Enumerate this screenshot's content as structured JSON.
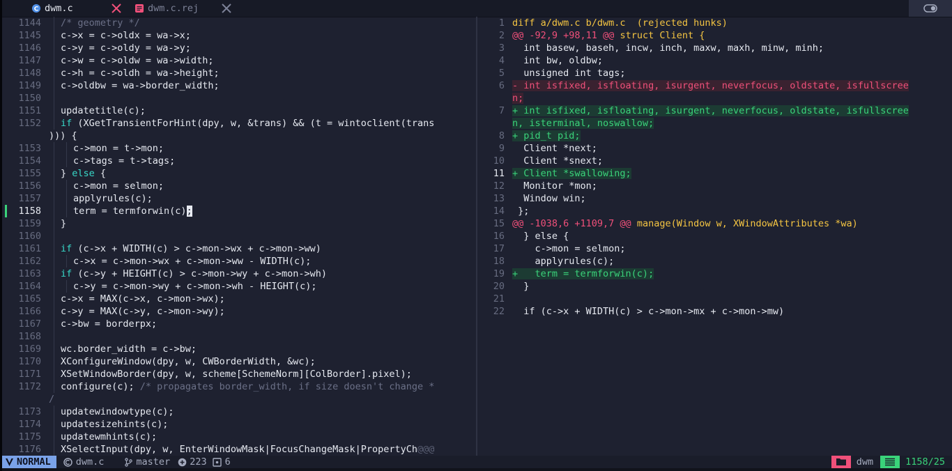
{
  "tabline": {
    "active_tab": "dwm.c",
    "inactive_tab": "dwm.c.rej"
  },
  "left_pane": {
    "lines": [
      {
        "n": "1144",
        "indent": 1,
        "parts": [
          {
            "t": "/* geometry */",
            "c": "cm"
          }
        ]
      },
      {
        "n": "1145",
        "indent": 1,
        "parts": [
          {
            "t": "c->x = c->oldx = wa->x;"
          }
        ]
      },
      {
        "n": "1146",
        "indent": 1,
        "parts": [
          {
            "t": "c->y = c->oldy = wa->y;"
          }
        ]
      },
      {
        "n": "1147",
        "indent": 1,
        "parts": [
          {
            "t": "c->w = c->oldw = wa->width;"
          }
        ]
      },
      {
        "n": "1148",
        "indent": 1,
        "parts": [
          {
            "t": "c->h = c->oldh = wa->height;"
          }
        ]
      },
      {
        "n": "1149",
        "indent": 1,
        "parts": [
          {
            "t": "c->oldbw = wa->border_width;"
          }
        ]
      },
      {
        "n": "1150",
        "indent": 1,
        "parts": []
      },
      {
        "n": "1151",
        "indent": 1,
        "parts": [
          {
            "t": "updatetitle(c);"
          }
        ]
      },
      {
        "n": "1152",
        "indent": 1,
        "parts": [
          {
            "t": "if",
            "c": "kw"
          },
          {
            "t": " (XGetTransientForHint(dpy, w, &trans) && (t = wintoclient(trans"
          }
        ]
      },
      {
        "n": "",
        "wrap": true,
        "parts": [
          {
            "t": "))) {"
          }
        ]
      },
      {
        "n": "1153",
        "indent": 2,
        "parts": [
          {
            "t": "c->mon = t->mon;"
          }
        ]
      },
      {
        "n": "1154",
        "indent": 2,
        "parts": [
          {
            "t": "c->tags = t->tags;"
          }
        ]
      },
      {
        "n": "1155",
        "indent": 1,
        "parts": [
          {
            "t": "} "
          },
          {
            "t": "else",
            "c": "kw"
          },
          {
            "t": " {"
          }
        ]
      },
      {
        "n": "1156",
        "indent": 2,
        "parts": [
          {
            "t": "c->mon = selmon;"
          }
        ]
      },
      {
        "n": "1157",
        "indent": 2,
        "parts": [
          {
            "t": "applyrules(c);"
          }
        ]
      },
      {
        "n": "1158",
        "indent": 2,
        "current": true,
        "sign": true,
        "parts": [
          {
            "t": "term = termforwin(c)"
          },
          {
            "t": ";",
            "c": "cursor"
          }
        ]
      },
      {
        "n": "1159",
        "indent": 1,
        "parts": [
          {
            "t": "}"
          }
        ]
      },
      {
        "n": "1160",
        "indent": 1,
        "parts": []
      },
      {
        "n": "1161",
        "indent": 1,
        "parts": [
          {
            "t": "if",
            "c": "kw"
          },
          {
            "t": " (c->x + WIDTH(c) > c->mon->wx + c->mon->ww)"
          }
        ]
      },
      {
        "n": "1162",
        "indent": 2,
        "parts": [
          {
            "t": "c->x = c->mon->wx + c->mon->ww - WIDTH(c);"
          }
        ]
      },
      {
        "n": "1163",
        "indent": 1,
        "parts": [
          {
            "t": "if",
            "c": "kw"
          },
          {
            "t": " (c->y + HEIGHT(c) > c->mon->wy + c->mon->wh)"
          }
        ]
      },
      {
        "n": "1164",
        "indent": 2,
        "parts": [
          {
            "t": "c->y = c->mon->wy + c->mon->wh - HEIGHT(c);"
          }
        ]
      },
      {
        "n": "1165",
        "indent": 1,
        "parts": [
          {
            "t": "c->x = MAX(c->x, c->mon->wx);"
          }
        ]
      },
      {
        "n": "1166",
        "indent": 1,
        "parts": [
          {
            "t": "c->y = MAX(c->y, c->mon->wy);"
          }
        ]
      },
      {
        "n": "1167",
        "indent": 1,
        "parts": [
          {
            "t": "c->bw = borderpx;"
          }
        ]
      },
      {
        "n": "1168",
        "indent": 1,
        "parts": []
      },
      {
        "n": "1169",
        "indent": 1,
        "parts": [
          {
            "t": "wc.border_width = c->bw;"
          }
        ]
      },
      {
        "n": "1170",
        "indent": 1,
        "parts": [
          {
            "t": "XConfigureWindow(dpy, w, CWBorderWidth, &wc);"
          }
        ]
      },
      {
        "n": "1171",
        "indent": 1,
        "parts": [
          {
            "t": "XSetWindowBorder(dpy, w, scheme[SchemeNorm][ColBorder].pixel);"
          }
        ]
      },
      {
        "n": "1172",
        "indent": 1,
        "parts": [
          {
            "t": "configure(c); "
          },
          {
            "t": "/* propagates border_width, if size doesn't change *",
            "c": "cm"
          }
        ]
      },
      {
        "n": "",
        "wrap": true,
        "parts": [
          {
            "t": "/",
            "c": "cm"
          }
        ]
      },
      {
        "n": "1173",
        "indent": 1,
        "parts": [
          {
            "t": "updatewindowtype(c);"
          }
        ]
      },
      {
        "n": "1174",
        "indent": 1,
        "parts": [
          {
            "t": "updatesizehints(c);"
          }
        ]
      },
      {
        "n": "1175",
        "indent": 1,
        "parts": [
          {
            "t": "updatewmhints(c);"
          }
        ]
      },
      {
        "n": "1176",
        "indent": 1,
        "parts": [
          {
            "t": "XSelectInput(dpy, w, EnterWindowMask|FocusChangeMask|PropertyCh"
          },
          {
            "t": "@@@",
            "c": "more"
          }
        ]
      }
    ]
  },
  "right_pane": {
    "lines": [
      {
        "n": "1",
        "parts": [
          {
            "t": "diff a/dwm.c b/dwm.c  (rejected hunks)",
            "c": "diff-header"
          }
        ]
      },
      {
        "n": "2",
        "parts": [
          {
            "t": "@@ -92,9 +98,11 @@",
            "c": "hunk-at"
          },
          {
            "t": " struct Client {",
            "c": "hunk-fn"
          }
        ]
      },
      {
        "n": "3",
        "parts": [
          {
            "t": "  int basew, baseh, incw, inch, maxw, maxh, minw, minh;"
          }
        ]
      },
      {
        "n": "4",
        "parts": [
          {
            "t": "  int bw, oldbw;"
          }
        ]
      },
      {
        "n": "5",
        "parts": [
          {
            "t": "  unsigned int tags;"
          }
        ]
      },
      {
        "n": "6",
        "parts": [
          {
            "t": "- int isfixed, isfloating, isurgent, neverfocus, oldstate, isfullscree",
            "c": "del"
          }
        ]
      },
      {
        "n": "",
        "wrap": true,
        "parts": [
          {
            "t": "n;",
            "c": "del"
          }
        ]
      },
      {
        "n": "7",
        "parts": [
          {
            "t": "+ int isfixed, isfloating, isurgent, neverfocus, oldstate, isfullscree",
            "c": "add"
          }
        ]
      },
      {
        "n": "",
        "wrap": true,
        "parts": [
          {
            "t": "n, isterminal, noswallow;",
            "c": "add"
          }
        ]
      },
      {
        "n": "8",
        "parts": [
          {
            "t": "+ pid_t pid;",
            "c": "add"
          }
        ]
      },
      {
        "n": "9",
        "parts": [
          {
            "t": "  Client *next;"
          }
        ]
      },
      {
        "n": "10",
        "parts": [
          {
            "t": "  Client *snext;"
          }
        ]
      },
      {
        "n": "11",
        "current": true,
        "parts": [
          {
            "t": "+ Client *swallowing;",
            "c": "add"
          }
        ]
      },
      {
        "n": "12",
        "parts": [
          {
            "t": "  Monitor *mon;"
          }
        ]
      },
      {
        "n": "13",
        "parts": [
          {
            "t": "  Window win;"
          }
        ]
      },
      {
        "n": "14",
        "parts": [
          {
            "t": " };"
          }
        ]
      },
      {
        "n": "15",
        "parts": [
          {
            "t": "@@ -1038,6 +1109,7 @@",
            "c": "hunk-at"
          },
          {
            "t": " manage(Window w, XWindowAttributes *wa)",
            "c": "hunk-fn"
          }
        ]
      },
      {
        "n": "16",
        "parts": [
          {
            "t": "  } else {"
          }
        ]
      },
      {
        "n": "17",
        "parts": [
          {
            "t": "    c->mon = selmon;"
          }
        ]
      },
      {
        "n": "18",
        "parts": [
          {
            "t": "    applyrules(c);"
          }
        ]
      },
      {
        "n": "19",
        "parts": [
          {
            "t": "+   term = termforwin(c);",
            "c": "add"
          }
        ]
      },
      {
        "n": "20",
        "parts": [
          {
            "t": "  }"
          }
        ]
      },
      {
        "n": "21",
        "parts": []
      },
      {
        "n": "22",
        "parts": [
          {
            "t": "  if (c->x + WIDTH(c) > c->mon->mx + c->mon->mw)"
          }
        ]
      }
    ]
  },
  "statusline": {
    "mode": "NORMAL",
    "file": "dwm.c",
    "branch": "master",
    "added": "223",
    "changed": "6",
    "session": "dwm",
    "position": "1158/25"
  },
  "colors": {
    "mode_bg": "#7aa2e8",
    "added": "#3ad37a",
    "removed": "#f0507a",
    "keyword": "#38d9c9",
    "hunk_fn": "#f5c542"
  },
  "icons": {
    "active_tab": "c-file-icon",
    "inactive_tab": "document-icon",
    "close": "close-icon",
    "branch": "git-branch-icon",
    "added": "plus-circle-icon",
    "changed": "dot-square-icon",
    "session": "folder-icon",
    "position": "lines-icon"
  }
}
